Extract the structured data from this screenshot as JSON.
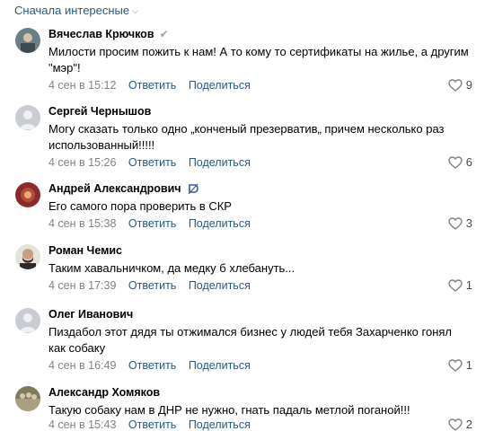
{
  "sort": {
    "label": "Сначала интересные"
  },
  "comments": [
    {
      "author": "Вячеслав Крючков",
      "text": "Милости просим пожить к нам! А то кому то сертификаты на жилье, а другим \"мэр\"!",
      "date": "4 сен в 15:12",
      "reply": "Ответить",
      "share": "Поделиться",
      "likes": "9",
      "avatar_color": "#6b7f86"
    },
    {
      "author": "Сергей Чернышов",
      "text": "Могу сказать только одно „конченый презерватив„ причем несколько раз использованный!!!!!",
      "date": "4 сен в 15:26",
      "reply": "Ответить",
      "share": "Поделиться",
      "likes": "6",
      "avatar_color": "#c9cdd3"
    },
    {
      "author": "Андрей Александрович",
      "text": "Его самого пора проверить в СКР",
      "date": "4 сен в 15:38",
      "reply": "Ответить",
      "share": "Поделиться",
      "likes": "3",
      "avatar_color": "#8b2a2a"
    },
    {
      "author": "Роман Чемис",
      "text": "Таким хавальничком, да медку б хлебануть...",
      "date": "4 сен в 17:39",
      "reply": "Ответить",
      "share": "Поделиться",
      "likes": "1",
      "avatar_color": "#4a4038"
    },
    {
      "author": "Олег Иванович",
      "text": "Пиздабол этот дядя ты отжимался бизнес у людей тебя Захарченко гонял как собаку",
      "date": "4 сен в 16:49",
      "reply": "Ответить",
      "share": "Поделиться",
      "likes": "1",
      "avatar_color": "#c9cdd3"
    },
    {
      "author": "Александр Хомяков",
      "text": "Такую собаку нам в ДНР не нужно, гнать падаль метлой поганой!!!",
      "date": "4 сен в 15:43",
      "reply": "Ответить",
      "share": "Поделиться",
      "likes": "2",
      "avatar_color": "#7d7a5e"
    }
  ]
}
